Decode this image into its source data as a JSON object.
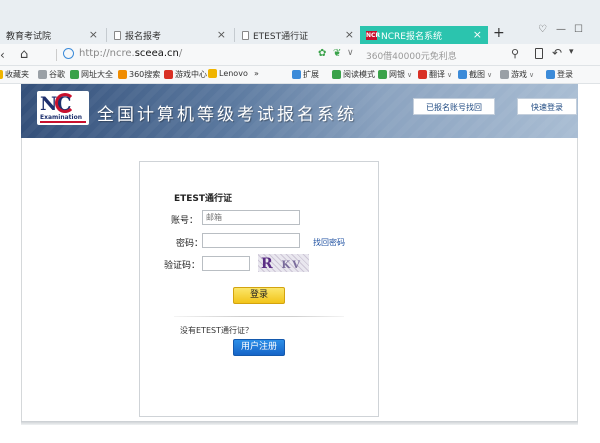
{
  "browser": {
    "tabs": [
      {
        "label": "教育考试院",
        "active": false
      },
      {
        "label": "报名报考",
        "active": false
      },
      {
        "label": "ETEST通行证",
        "active": false
      },
      {
        "label": "NCRE报名系统",
        "active": true
      }
    ],
    "tab_close": "×",
    "favicon_text": "NCR",
    "new_tab": "+",
    "window_controls": [
      "♡",
      "—",
      "☐"
    ],
    "url_prefix": "http://ncre.",
    "url_domain": "sceea.cn",
    "url_suffix": "/",
    "search_placeholder": "360借40000元免利息",
    "bookmarks": [
      {
        "label": "收藏夹",
        "icon_color": "#f0b400"
      },
      {
        "label": "谷歌",
        "icon_color": "#9aa0a6"
      },
      {
        "label": "网址大全",
        "icon_color": "#3aa24a"
      },
      {
        "label": "360搜索",
        "icon_color": "#f08c00"
      },
      {
        "label": "游戏中心",
        "icon_color": "#d93025"
      },
      {
        "label": "Lenovo",
        "icon_color": "#f0b400"
      },
      {
        "label": "»",
        "icon_color": ""
      },
      {
        "label": "扩展",
        "icon_color": "#3c8bd9"
      },
      {
        "label": "阅读模式",
        "icon_color": "#3aa24a"
      },
      {
        "label": "网银",
        "icon_color": "#3aa24a"
      },
      {
        "label": "翻译",
        "icon_color": "#d93025"
      },
      {
        "label": "截图",
        "icon_color": "#3c8bd9"
      },
      {
        "label": "游戏",
        "icon_color": "#9aa0a6"
      },
      {
        "label": "登录",
        "icon_color": "#3c8bd9"
      }
    ]
  },
  "header": {
    "logo_main": "NC",
    "logo_sub": "Examination",
    "title": "全国计算机等级考试报名系统",
    "btn_find_account": "已报名账号找回",
    "btn_quick_login": "快速登录",
    "colors": {
      "dark": "#34507a",
      "light": "#a9bdd3"
    }
  },
  "login": {
    "title": "ETEST通行证",
    "account_label": "账号：",
    "account_placeholder": "邮箱",
    "password_label": "密码：",
    "captcha_label": "验证码：",
    "forgot_password": "找回密码",
    "captcha_chars": [
      "R",
      "KV",
      "Z"
    ],
    "login_button": "登录",
    "no_account_text": "没有ETEST通行证？",
    "register_button": "用户注册",
    "colors": {
      "login_btn": "#f2c41a",
      "register_btn": "#1665c8",
      "link": "#1d4fa0"
    }
  }
}
